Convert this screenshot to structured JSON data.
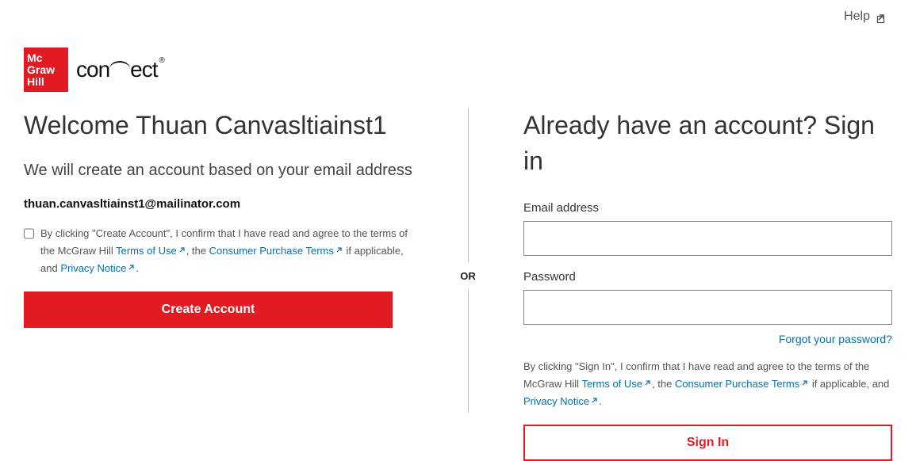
{
  "header": {
    "help_label": "Help",
    "logo_mc": "Mc",
    "logo_graw": "Graw",
    "logo_hill": "Hill",
    "connect_pre": "con",
    "connect_post": "ect"
  },
  "left": {
    "welcome_title": "Welcome Thuan Canvasltiainst1",
    "subheader": "We will create an account based on your email address",
    "email": "thuan.canvasltiainst1@mailinator.com",
    "terms_prefix": "By clicking \"Create Account\", I confirm that I have read and agree to the terms of the McGraw Hill ",
    "terms_of_use": "Terms of Use",
    "terms_mid1": ", the ",
    "consumer_terms": "Consumer Purchase Terms",
    "terms_mid2": " if applicable, and ",
    "privacy_notice": "Privacy Notice",
    "terms_end": ".",
    "create_button": "Create Account"
  },
  "divider": {
    "or": "OR"
  },
  "right": {
    "title": "Already have an account? Sign in",
    "email_label": "Email address",
    "password_label": "Password",
    "forgot": "Forgot your password?",
    "terms_prefix": "By clicking \"Sign In\", I confirm that I have read and agree to the terms of the McGraw Hill ",
    "terms_of_use": "Terms of Use",
    "terms_mid1": ", the ",
    "consumer_terms": "Consumer Purchase Terms",
    "terms_mid2": " if applicable, and ",
    "privacy_notice": "Privacy Notice",
    "terms_end": ".",
    "signin_button": "Sign In"
  }
}
